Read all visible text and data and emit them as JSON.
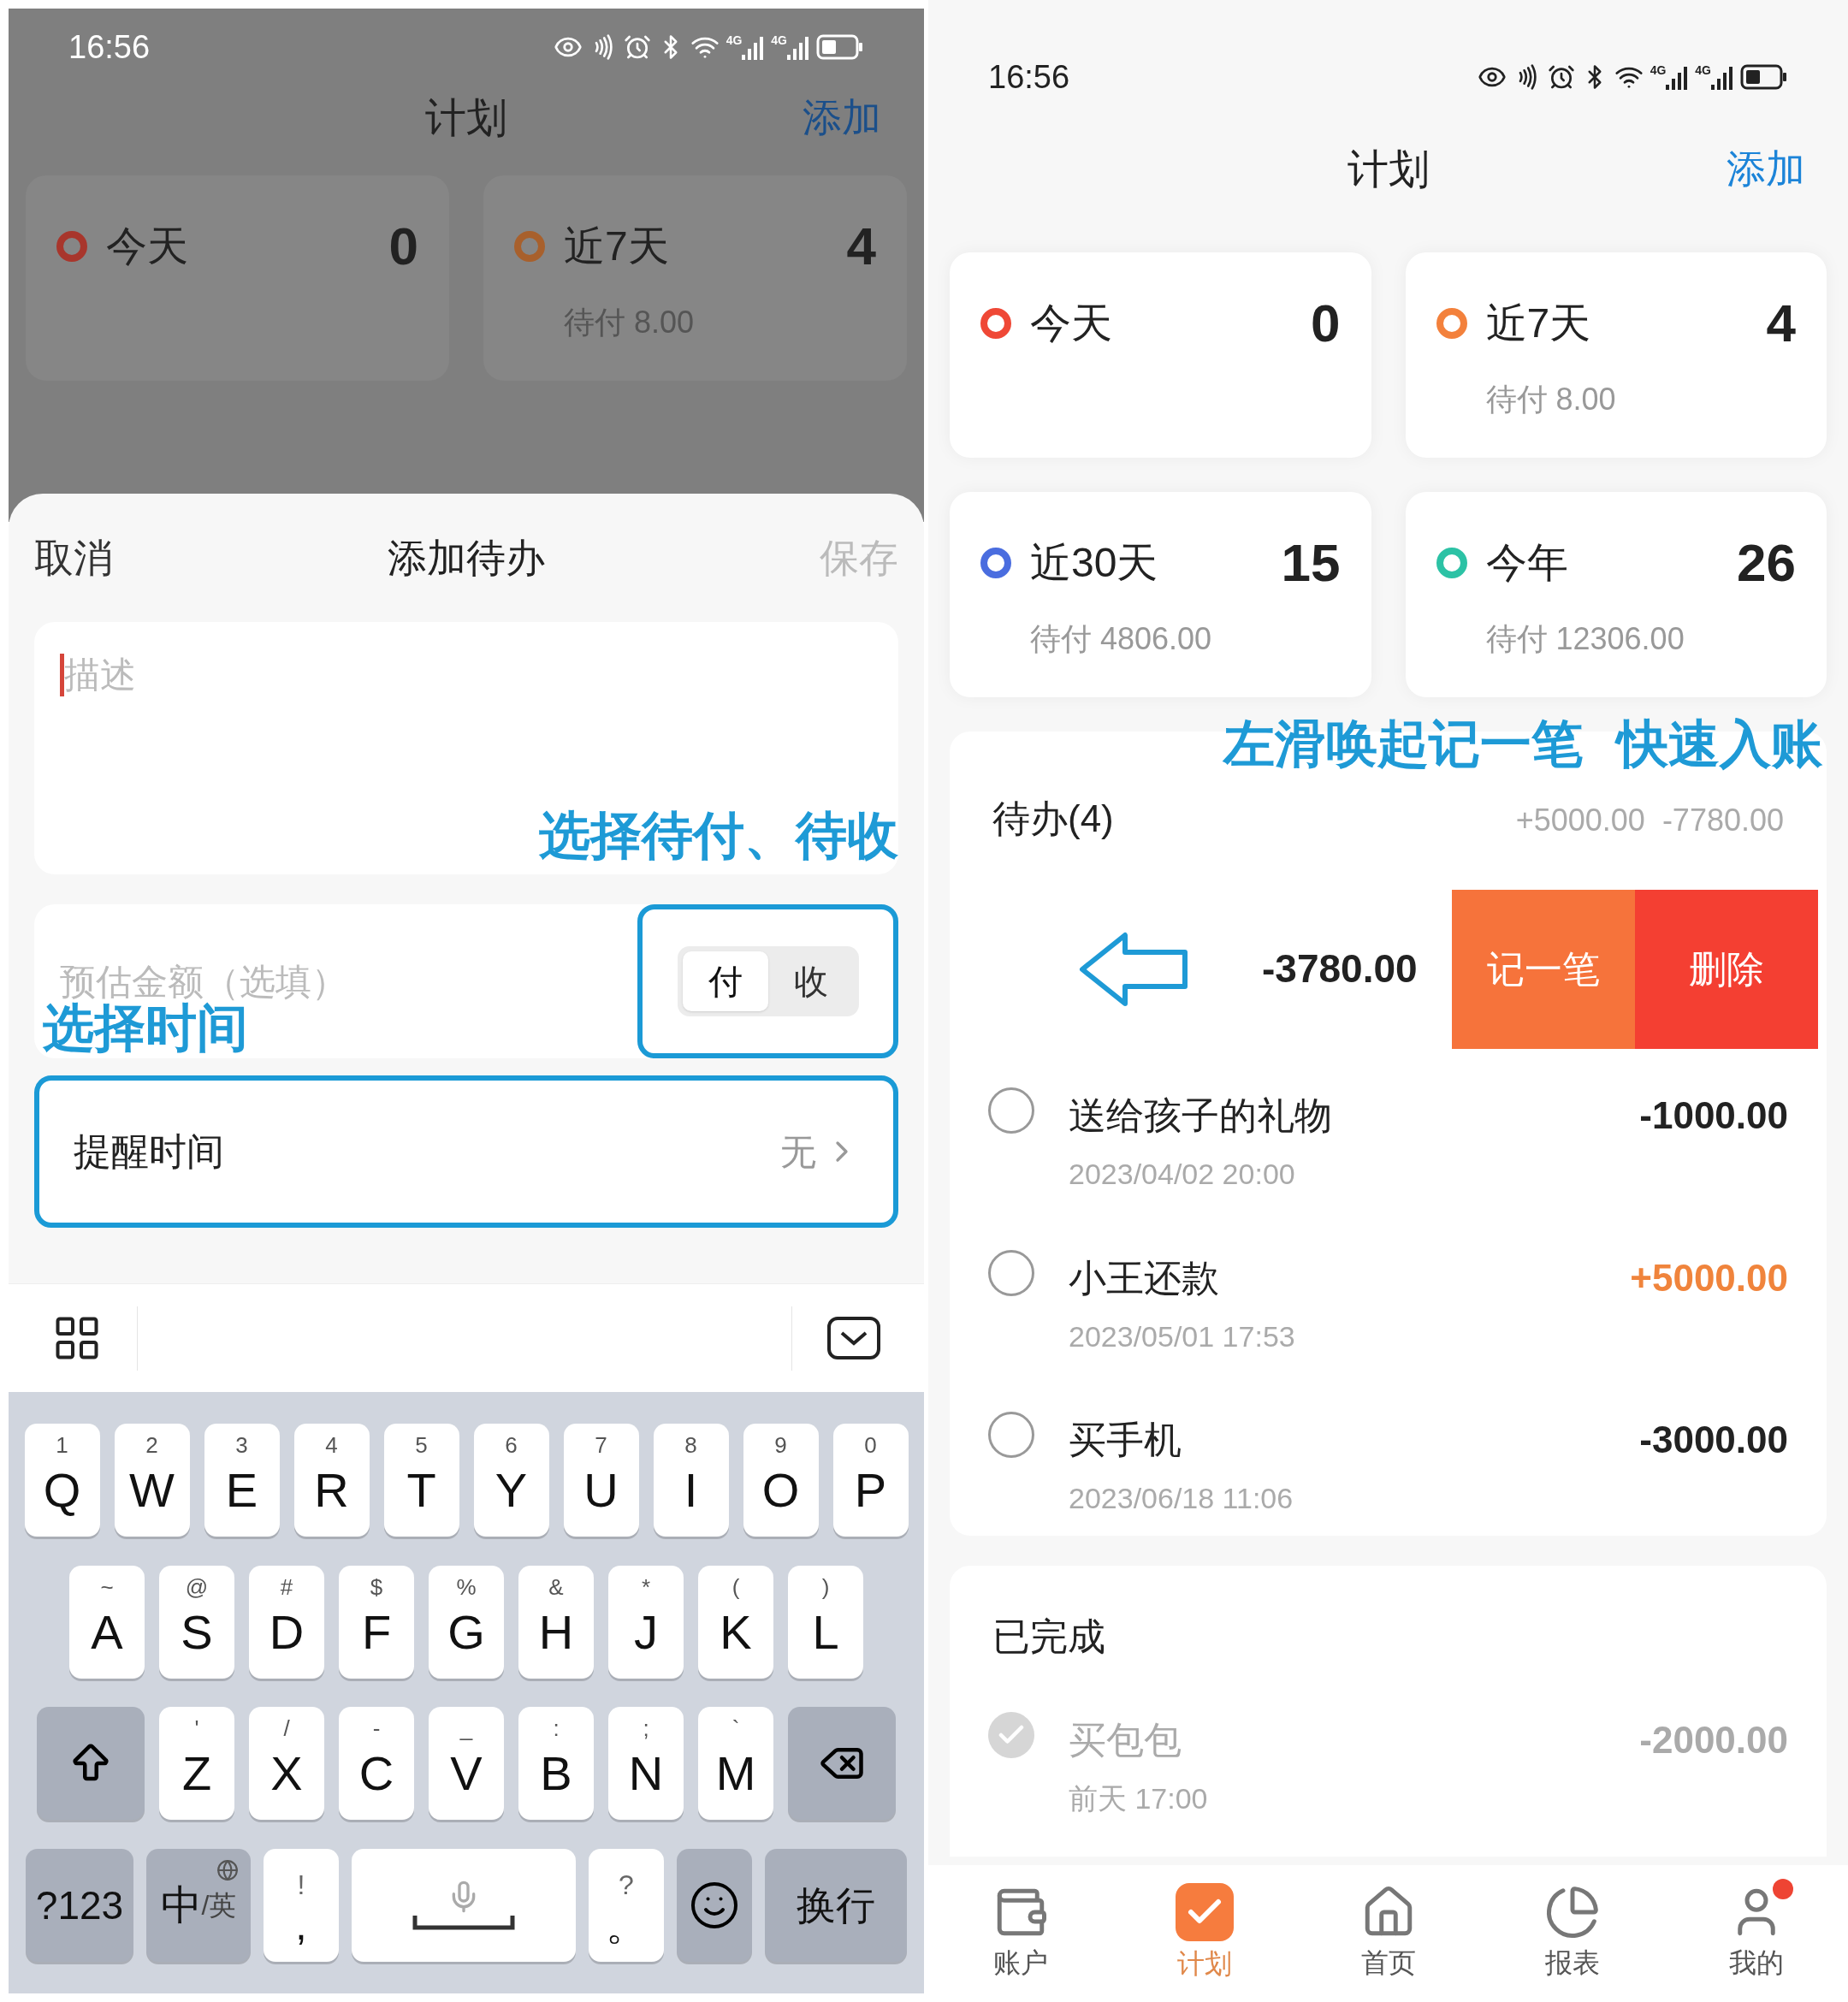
{
  "left": {
    "status_bar": {
      "time": "16:56",
      "network": [
        "4G",
        "4G"
      ]
    },
    "header": {
      "title": "计划",
      "action": "添加"
    },
    "stat_cards": [
      {
        "label": "今天",
        "count": "0",
        "color": "#a8362c"
      },
      {
        "label": "近7天",
        "count": "4",
        "sub": "待付 8.00",
        "color": "#a8602c"
      }
    ],
    "sheet": {
      "cancel": "取消",
      "title": "添加待办",
      "save": "保存",
      "description": {
        "placeholder": "描述"
      },
      "annotation_type": "选择待付、待收",
      "amount": {
        "placeholder": "预估金额（选填）"
      },
      "type_toggle": [
        {
          "label": "付",
          "selected": true
        },
        {
          "label": "收",
          "selected": false
        }
      ],
      "annotation_time": "选择时间",
      "reminder": {
        "label": "提醒时间",
        "value": "无"
      }
    },
    "keyboard": {
      "rows": [
        [
          {
            "kind": "letter",
            "key": "Q",
            "hint": "1"
          },
          {
            "kind": "letter",
            "key": "W",
            "hint": "2"
          },
          {
            "kind": "letter",
            "key": "E",
            "hint": "3"
          },
          {
            "kind": "letter",
            "key": "R",
            "hint": "4"
          },
          {
            "kind": "letter",
            "key": "T",
            "hint": "5"
          },
          {
            "kind": "letter",
            "key": "Y",
            "hint": "6"
          },
          {
            "kind": "letter",
            "key": "U",
            "hint": "7"
          },
          {
            "kind": "letter",
            "key": "I",
            "hint": "8"
          },
          {
            "kind": "letter",
            "key": "O",
            "hint": "9"
          },
          {
            "kind": "letter",
            "key": "P",
            "hint": "0"
          }
        ],
        [
          {
            "kind": "letter",
            "key": "A",
            "hint": "~"
          },
          {
            "kind": "letter",
            "key": "S",
            "hint": "@"
          },
          {
            "kind": "letter",
            "key": "D",
            "hint": "#"
          },
          {
            "kind": "letter",
            "key": "F",
            "hint": "$"
          },
          {
            "kind": "letter",
            "key": "G",
            "hint": "%"
          },
          {
            "kind": "letter",
            "key": "H",
            "hint": "&"
          },
          {
            "kind": "letter",
            "key": "J",
            "hint": "*"
          },
          {
            "kind": "letter",
            "key": "K",
            "hint": "("
          },
          {
            "kind": "letter",
            "key": "L",
            "hint": ")"
          }
        ],
        [
          {
            "kind": "shift"
          },
          {
            "kind": "letter",
            "key": "Z",
            "hint": "'"
          },
          {
            "kind": "letter",
            "key": "X",
            "hint": "/"
          },
          {
            "kind": "letter",
            "key": "C",
            "hint": "-"
          },
          {
            "kind": "letter",
            "key": "V",
            "hint": "_"
          },
          {
            "kind": "letter",
            "key": "B",
            "hint": ":"
          },
          {
            "kind": "letter",
            "key": "N",
            "hint": ";"
          },
          {
            "kind": "letter",
            "key": "M",
            "hint": "`"
          },
          {
            "kind": "backspace"
          }
        ]
      ],
      "bottom_row": [
        {
          "kind": "function",
          "key": "?123"
        },
        {
          "kind": "lang",
          "key": "中",
          "sub": "/英"
        },
        {
          "kind": "punct",
          "key": ",",
          "hint": "!"
        },
        {
          "kind": "space"
        },
        {
          "kind": "punct",
          "key": "。",
          "hint": "?"
        },
        {
          "kind": "emoji"
        },
        {
          "kind": "function",
          "key": "换行"
        }
      ]
    }
  },
  "right": {
    "status_bar": {
      "time": "16:56",
      "network": [
        "4G",
        "4G"
      ]
    },
    "header": {
      "title": "计划",
      "action": "添加"
    },
    "stat_cards": [
      {
        "label": "今天",
        "count": "0",
        "color": "#ef4836"
      },
      {
        "label": "近7天",
        "count": "4",
        "sub": "待付 8.00",
        "color": "#f3813c"
      },
      {
        "label": "近30天",
        "count": "15",
        "sub": "待付 4806.00",
        "color": "#4a6ddf"
      },
      {
        "label": "今年",
        "count": "26",
        "sub": "待付 12306.00",
        "color": "#2cc2a5"
      }
    ],
    "annotation_swipe": [
      "左滑唤起记一笔",
      "快速入账"
    ],
    "todo": {
      "title": "待办(4)",
      "income_total": "+5000.00",
      "expense_total": "-7780.00",
      "swiped_row": {
        "amount": "-3780.00",
        "actions": [
          {
            "label": "记一笔",
            "color": "#f6733b"
          },
          {
            "label": "删除",
            "color": "#f43f32"
          }
        ]
      },
      "items": [
        {
          "title": "送给孩子的礼物",
          "date": "2023/04/02 20:00",
          "amount": "-1000.00",
          "color": "#222222",
          "checked": false
        },
        {
          "title": "小王还款",
          "date": "2023/05/01 17:53",
          "amount": "+5000.00",
          "color": "#f0843c",
          "checked": false
        },
        {
          "title": "买手机",
          "date": "2023/06/18 11:06",
          "amount": "-3000.00",
          "color": "#222222",
          "checked": false
        }
      ]
    },
    "done": {
      "title": "已完成",
      "items": [
        {
          "title": "买包包",
          "date": "前天 17:00",
          "amount": "-2000.00",
          "checked": true
        }
      ]
    },
    "nav": [
      {
        "label": "账户",
        "selected": false
      },
      {
        "label": "计划",
        "selected": true
      },
      {
        "label": "首页",
        "selected": false
      },
      {
        "label": "报表",
        "selected": false
      },
      {
        "label": "我的",
        "selected": false,
        "badge": true
      }
    ]
  }
}
